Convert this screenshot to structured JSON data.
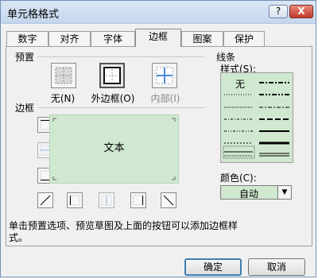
{
  "title": "单元格格式",
  "title_buttons": {
    "help": "?",
    "close": "X"
  },
  "tabs": [
    "数字",
    "对齐",
    "字体",
    "边框",
    "图案",
    "保护"
  ],
  "active_tab": "边框",
  "sections": {
    "preset": "预置",
    "border": "边框",
    "line": "线条"
  },
  "presets": [
    {
      "label": "无(N)"
    },
    {
      "label": "外边框(O)"
    },
    {
      "label": "内部(I)"
    }
  ],
  "preview_text": "文本",
  "line": {
    "style_label": "样式(S):",
    "none_label": "无"
  },
  "color": {
    "label": "颜色(C):",
    "value": "自动"
  },
  "hint": "单击预置选项、预览草图及上面的按钮可以添加边框样式。",
  "buttons": {
    "ok": "确定",
    "cancel": "取消"
  }
}
